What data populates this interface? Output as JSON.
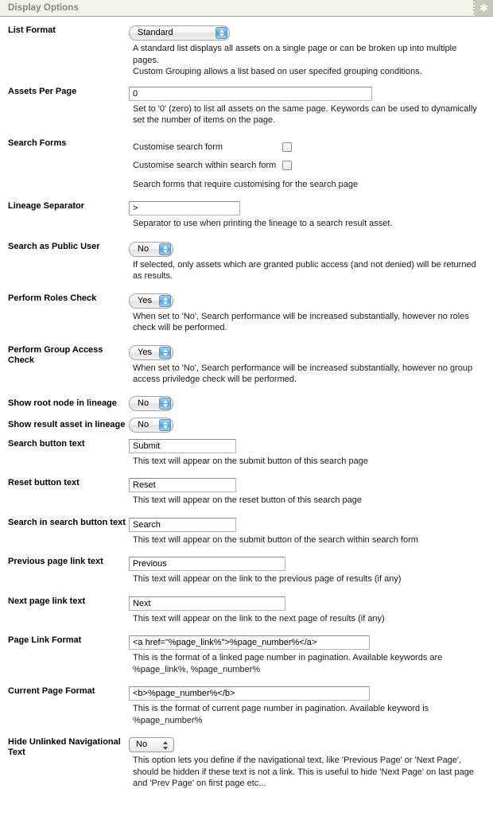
{
  "header": {
    "title": "Display Options",
    "action_icon": "asterisk-icon",
    "action_glyph": "✻"
  },
  "colors": {
    "header_bg": "#f4f3e9",
    "header_text": "#86867a",
    "header_button": "#c9c9bb",
    "border": "#a9a9a0"
  },
  "fields": [
    {
      "label": "List Format",
      "control": "select",
      "value": "Standard",
      "desc": "A standard list displays all assets on a single page or can be broken up into multiple pages.\nCustom Grouping allows a list based on user specifed grouping conditions."
    },
    {
      "label": "Assets Per Page",
      "control": "text",
      "value": "0",
      "desc": "Set to '0' (zero) to list all assets on the same page. Keywords can be used to dynamically set the number of items on the page."
    },
    {
      "label": "Search Forms",
      "control": "checkboxes",
      "checkboxes": [
        {
          "label": "Customise search form",
          "checked": false
        },
        {
          "label": "Customise search within search form",
          "checked": false
        }
      ],
      "desc": "Search forms that require customising for the search page"
    },
    {
      "label": "Lineage Separator",
      "control": "text",
      "value": ">",
      "desc": "Separator to use when printing the lineage to a search result asset."
    },
    {
      "label": "Search as Public User",
      "control": "select",
      "value": "No",
      "desc": "If selected, only assets which are granted public access (and not denied) will be returned as results."
    },
    {
      "label": "Perform Roles Check",
      "control": "select",
      "value": "Yes",
      "desc": "When set to 'No', Search performance will be increased substantially, however no roles check will be performed."
    },
    {
      "label": "Perform Group Access Check",
      "control": "select",
      "value": "Yes",
      "desc": "When set to 'No', Search performance will be increased substantially, however no group access priviledge check will be performed."
    },
    {
      "label": "Show root node in lineage",
      "control": "select",
      "value": "No",
      "desc": ""
    },
    {
      "label": "Show result asset in lineage",
      "control": "select",
      "value": "No",
      "desc": ""
    },
    {
      "label": "Search button text",
      "control": "text",
      "value": "Submit",
      "desc": "This text will appear on the submit button of this search page"
    },
    {
      "label": "Reset button text",
      "control": "text",
      "value": "Reset",
      "desc": "This text will appear on the reset button of this search page"
    },
    {
      "label": "Search in search button text",
      "control": "text",
      "value": "Search",
      "desc": "This text will appear on the submit button of the search within search form"
    },
    {
      "label": "Previous page link text",
      "control": "text",
      "value": "Previous",
      "desc": "This text will appear on the link to the previous page of results (if any)"
    },
    {
      "label": "Next page link text",
      "control": "text",
      "value": "Next",
      "desc": "This text will appear on the link to the next page of results (if any)"
    },
    {
      "label": "Page Link Format",
      "control": "text",
      "value": "<a href=\"%page_link%\">%page_number%</a>",
      "desc": "This is the format of a linked page number in pagination. Available keywords are %page_link%, %page_number%"
    },
    {
      "label": "Current Page Format",
      "control": "text",
      "value": "<b>%page_number%</b>",
      "desc": "This is the format of current page number in pagination. Available keyword is %page_number%"
    },
    {
      "label": "Hide Unlinked Navigational Text",
      "control": "plain-select",
      "value": "No",
      "desc": "This option lets you define if the navigational text, like 'Previous Page' or 'Next Page', should be hidden if these text is not a link. This is useful to hide 'Next Page' on last page and 'Prev Page' on first page etc..."
    }
  ]
}
